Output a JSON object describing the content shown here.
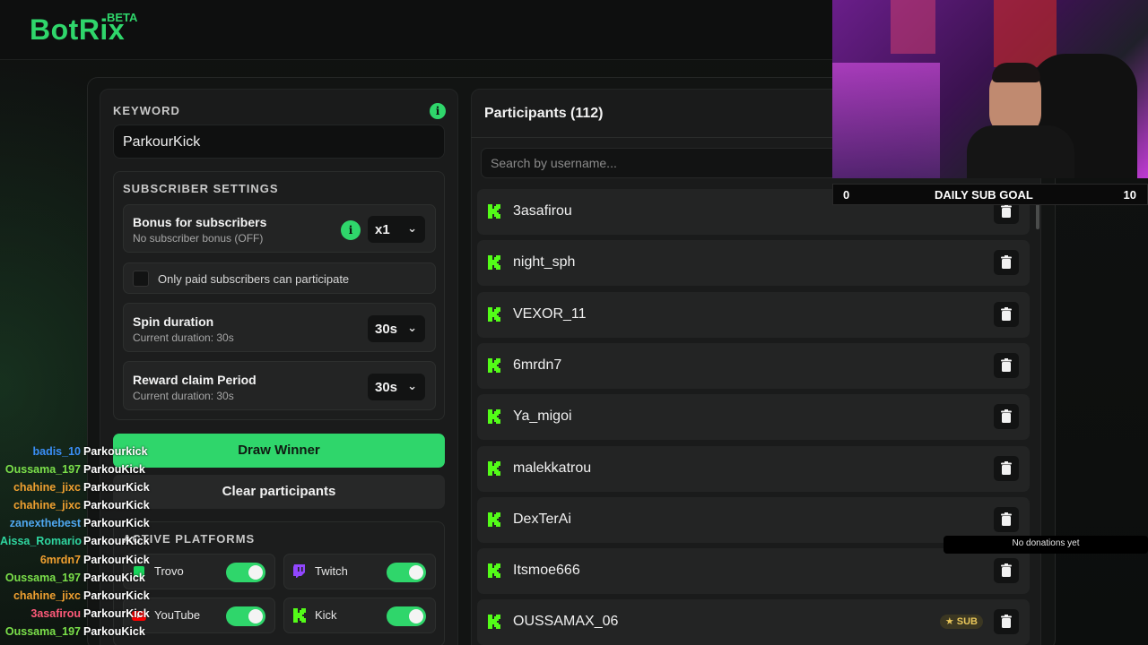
{
  "brand": {
    "name": "BotRix",
    "tag": "BETA",
    "accent": "#2fd66b"
  },
  "keyword": {
    "label": "KEYWORD",
    "value": "ParkourKick",
    "info_icon": "info-icon"
  },
  "subscriber_settings": {
    "heading": "SUBSCRIBER SETTINGS",
    "bonus": {
      "title": "Bonus for subscribers",
      "subtitle": "No subscriber bonus (OFF)",
      "multiplier": "x1"
    },
    "paid_only": {
      "label": "Only paid subscribers can participate",
      "checked": false
    },
    "spin": {
      "title": "Spin duration",
      "subtitle": "Current duration: 30s",
      "value": "30s"
    },
    "reward": {
      "title": "Reward claim Period",
      "subtitle": "Current duration: 30s",
      "value": "30s"
    }
  },
  "actions": {
    "draw": "Draw Winner",
    "clear": "Clear participants"
  },
  "platforms": {
    "heading": "ACTIVE PLATFORMS",
    "items": [
      {
        "name": "Trovo",
        "icon": "trovo-icon",
        "enabled": true
      },
      {
        "name": "Twitch",
        "icon": "twitch-icon",
        "enabled": true
      },
      {
        "name": "YouTube",
        "icon": "youtube-icon",
        "enabled": true
      },
      {
        "name": "Kick",
        "icon": "kick-icon",
        "enabled": true
      }
    ]
  },
  "participants": {
    "title": "Participants (112)",
    "search_placeholder": "Search by username...",
    "list": [
      {
        "name": "3asafirou",
        "sub": false
      },
      {
        "name": "night_sph",
        "sub": false
      },
      {
        "name": "VEXOR_11",
        "sub": false
      },
      {
        "name": "6mrdn7",
        "sub": false
      },
      {
        "name": "Ya_migoi",
        "sub": false
      },
      {
        "name": "malekkatrou",
        "sub": false
      },
      {
        "name": "DexTerAi",
        "sub": false
      },
      {
        "name": "Itsmoe666",
        "sub": false
      },
      {
        "name": "OUSSAMAX_06",
        "sub": true,
        "badge": "SUB"
      }
    ]
  },
  "stream_overlay": {
    "sub_goal": {
      "current": "0",
      "label": "DAILY SUB GOAL",
      "target": "10"
    },
    "donations": "No donations yet"
  },
  "chat": [
    {
      "user": "badis_10",
      "color": "#3a8ef6",
      "msg": "Parkourkick"
    },
    {
      "user": "Oussama_197",
      "color": "#7be04a",
      "msg": "ParkouKick"
    },
    {
      "user": "chahine_jixc",
      "color": "#f0a030",
      "msg": "ParkourKick"
    },
    {
      "user": "chahine_jixc",
      "color": "#f0a030",
      "msg": "ParkourKick"
    },
    {
      "user": "zanexthebest",
      "color": "#4fa8f0",
      "msg": "ParkourKick"
    },
    {
      "user": "Aissa_Romario",
      "color": "#2fd6a0",
      "msg": "ParkourKick"
    },
    {
      "user": "6mrdn7",
      "color": "#f0a030",
      "msg": "ParkourKick"
    },
    {
      "user": "Oussama_197",
      "color": "#7be04a",
      "msg": "ParkouKick"
    },
    {
      "user": "chahine_jixc",
      "color": "#f0a030",
      "msg": "ParkourKick"
    },
    {
      "user": "3asafirou",
      "color": "#ff5a7a",
      "msg": "ParkourKick"
    },
    {
      "user": "Oussama_197",
      "color": "#7be04a",
      "msg": "ParkouKick"
    }
  ]
}
